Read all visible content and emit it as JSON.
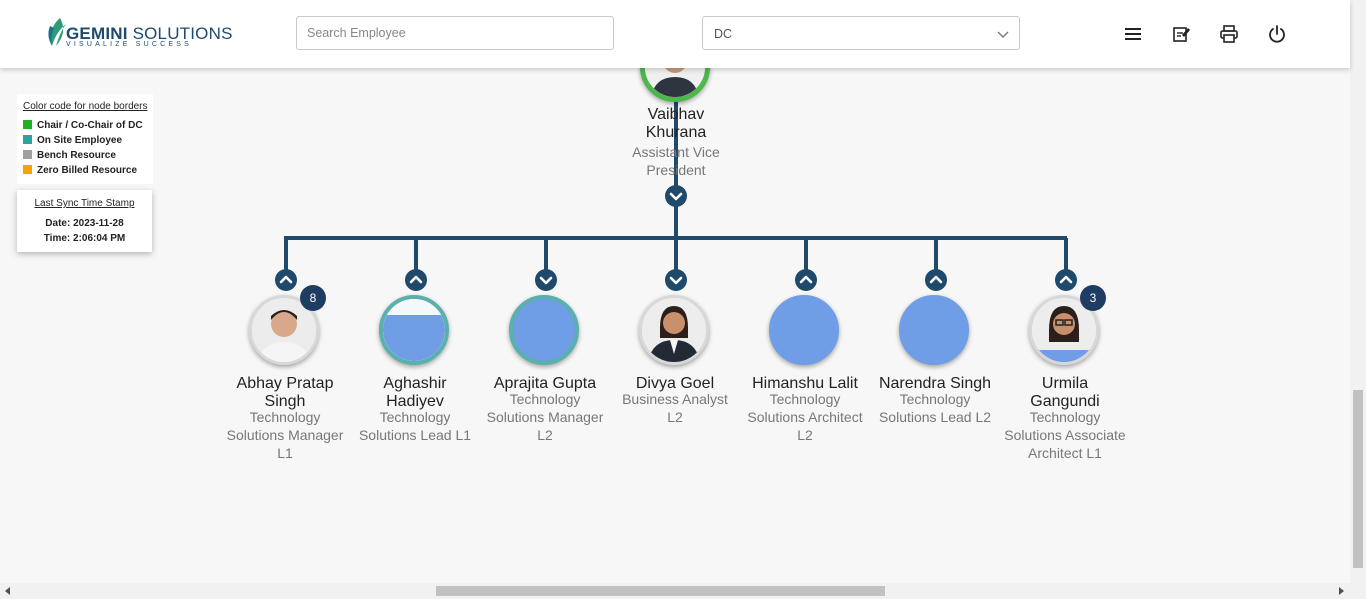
{
  "header": {
    "logo_main": "GEMINI",
    "logo_main_light": " SOLUTIONS",
    "logo_tagline": "VISUALIZE SUCCESS",
    "search_placeholder": "Search Employee",
    "search_value": "",
    "department_select": "DC",
    "icons": [
      "menu-icon",
      "edit-note-icon",
      "print-icon",
      "power-icon"
    ]
  },
  "legend": {
    "title": "Color code for node borders",
    "items": [
      {
        "label": "Chair / Co-Chair of DC",
        "color": "#22b022"
      },
      {
        "label": "On Site Employee",
        "color": "#2ba3a0"
      },
      {
        "label": "Bench Resource",
        "color": "#a0a0a0"
      },
      {
        "label": "Zero Billed Resource",
        "color": "#f4a30c"
      }
    ]
  },
  "sync": {
    "title": "Last Sync Time Stamp",
    "date": "Date: 2023-11-28",
    "time": "Time: 2:06:04 PM"
  },
  "root": {
    "name": "Vaibhav Khurana",
    "role": "Assistant Vice President",
    "border": "#4cb84c"
  },
  "children": [
    {
      "name": "Abhay Pratap Singh",
      "role": "Technology Solutions Manager L1",
      "badge": "8",
      "border": "#d8d8d8",
      "photo": "male"
    },
    {
      "name": "Aghashir Hadiyev",
      "role": "Technology Solutions Lead L1",
      "badge": "",
      "border": "#5ab0ad",
      "photo": "partial"
    },
    {
      "name": "Aprajita Gupta",
      "role": "Technology Solutions Manager L2",
      "badge": "",
      "border": "#5ab0ad",
      "photo": "none"
    },
    {
      "name": "Divya Goel",
      "role": "Business Analyst L2",
      "badge": "",
      "border": "#d8d8d8",
      "photo": "female-suit"
    },
    {
      "name": "Himanshu Lalit",
      "role": "Technology Solutions Architect L2",
      "badge": "",
      "border": "#6f9ee6",
      "photo": "none"
    },
    {
      "name": "Narendra Singh",
      "role": "Technology Solutions Lead L2",
      "badge": "",
      "border": "#6f9ee6",
      "photo": "none"
    },
    {
      "name": "Urmila Gangundi",
      "role": "Technology Solutions Associate Architect L1",
      "badge": "3",
      "border": "#d8d8d8",
      "photo": "female-glasses"
    }
  ]
}
